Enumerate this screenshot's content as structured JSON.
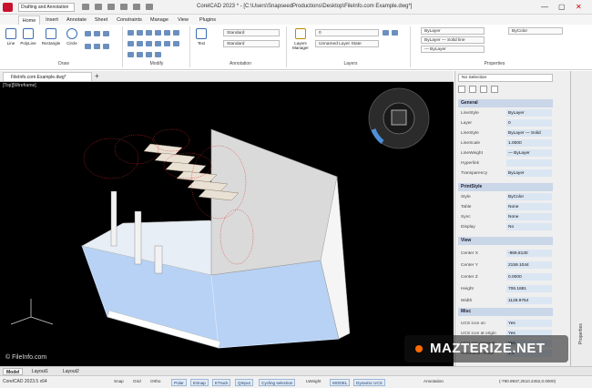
{
  "titlebar": {
    "workspace": "Drafting and Annotation",
    "title": "CorelCAD 2023 * - [C:\\Users\\SnapseedProductions\\Desktop\\FileInfo.com Example.dwg*]",
    "minimize": "—",
    "maximize": "▢",
    "close": "✕"
  },
  "ribbon_tabs": [
    "Home",
    "Insert",
    "Annotate",
    "Sheet",
    "Constraints",
    "Manage",
    "View",
    "Plugins"
  ],
  "ribbon": {
    "draw_tools": [
      "Line",
      "PolyLine",
      "Rectangle",
      "Circle"
    ],
    "panel_draw": "Draw",
    "panel_modify": "Modify",
    "panel_annotation": "Annotation",
    "panel_layers": "Layers",
    "panel_properties": "Properties",
    "text_tool": "Text",
    "annotation_style_1": "Standard",
    "annotation_style_2": "Standard",
    "layers_btn": "Layers Manager",
    "layer_name": "0",
    "layer_state": "Unnamed Layer State",
    "color": "ByLayer",
    "linestyle": "ByLayer — Solid line",
    "lineweight": "— ByLayer",
    "color2": "ByColor"
  },
  "doc": {
    "tab": "FileInfo.com Example.dwg*",
    "plus": "+"
  },
  "viewport": {
    "label": "[Top][Wireframe]",
    "watermark": "© FileInfo.com"
  },
  "properties": {
    "selector": "No Selection",
    "sections": {
      "general": "General",
      "printstyle": "PrintStyle",
      "view": "View",
      "misc": "Misc"
    },
    "general_rows": [
      {
        "k": "LineStyle",
        "v": "ByLayer"
      },
      {
        "k": "Layer",
        "v": "0"
      },
      {
        "k": "LineStyle",
        "v": "ByLayer — Solid"
      },
      {
        "k": "LineScale",
        "v": "1.0000"
      },
      {
        "k": "LineWeight",
        "v": "— ByLayer"
      },
      {
        "k": "Hyperlink",
        "v": ""
      },
      {
        "k": "Transparency",
        "v": "ByLayer"
      }
    ],
    "printstyle_rows": [
      {
        "k": "Style",
        "v": "ByColor"
      },
      {
        "k": "Table",
        "v": "None"
      },
      {
        "k": "Sync",
        "v": "None"
      },
      {
        "k": "Display",
        "v": "No"
      }
    ],
    "view_rows": [
      {
        "k": "Center X",
        "v": "-969.8130"
      },
      {
        "k": "Center Y",
        "v": "2159.1044"
      },
      {
        "k": "Center Z",
        "v": "0.0000"
      },
      {
        "k": "Height",
        "v": "706.1881"
      },
      {
        "k": "Width",
        "v": "1128.9754"
      }
    ],
    "misc_rows": [
      {
        "k": "UCS icon on",
        "v": "Yes"
      },
      {
        "k": "UCS icon at origin",
        "v": "Yes"
      },
      {
        "k": "UCS per viewport",
        "v": "Yes"
      },
      {
        "k": "Annotation Scale",
        "v": "1:1"
      }
    ],
    "side_label": "Properties"
  },
  "layout_tabs": [
    "Model",
    "Layout1",
    "Layout2"
  ],
  "statusbar": {
    "version": "CorelCAD 2023.5 x64",
    "buttons": [
      "Snap",
      "Grid",
      "Ortho",
      "Polar",
      "ESnap",
      "ETrack",
      "QInput",
      "Cycling selection",
      "LWeight",
      "MODEL",
      "Dynamic UCS",
      "Annotation"
    ],
    "coords": "(-790.9937,2510.2452,0.0000)"
  },
  "brand": "MAZTERIZE.NET"
}
